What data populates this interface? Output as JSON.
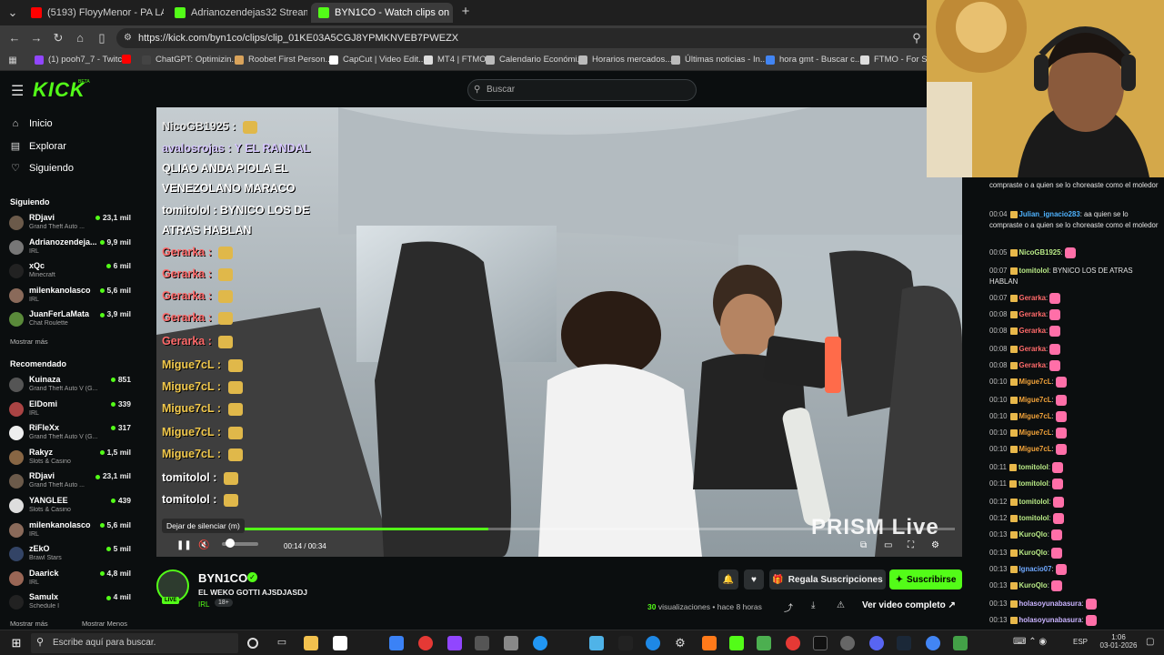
{
  "browser": {
    "tabs": [
      {
        "title": "(5193) FloyyMenor - PA LA EUR",
        "color": "#ff0000"
      },
      {
        "title": "Adrianozendejas32 Stream - W",
        "color": "#53fc18"
      },
      {
        "title": "BYN1CO - Watch clips on K",
        "color": "#53fc18",
        "active": true
      }
    ],
    "new_tab": "+",
    "url": "https://kick.com/byn1co/clips/clip_01KE03A5CGJ8YPMKNVEB7PWEZX",
    "bookmarks": [
      {
        "label": "(1) pooh7_7 - Twitch",
        "color": "#9146ff"
      },
      {
        "label": "",
        "color": "#ff0000"
      },
      {
        "label": "ChatGPT: Optimizin...",
        "color": "#444444"
      },
      {
        "label": "Roobet First Person...",
        "color": "#d9a35b"
      },
      {
        "label": "CapCut | Video Edit...",
        "color": "#ffffff"
      },
      {
        "label": "MT4 | FTMO",
        "color": "#dddddd"
      },
      {
        "label": "Calendario Económi...",
        "color": "#bbbbbb"
      },
      {
        "label": "Horarios mercados...",
        "color": "#bbbbbb"
      },
      {
        "label": "Últimas noticias - In...",
        "color": "#bbbbbb"
      },
      {
        "label": "hora gmt - Buscar c...",
        "color": "#4285f4"
      },
      {
        "label": "FTMO - For Serio",
        "color": "#dddddd"
      }
    ]
  },
  "kick": {
    "logo": "KICK",
    "logo_beta": "BETA",
    "search_placeholder": "Buscar",
    "nav": [
      "Inicio",
      "Explorar",
      "Siguiendo"
    ],
    "following_header": "Siguiendo",
    "following": [
      {
        "name": "RDjavi",
        "category": "Grand Theft Auto ...",
        "viewers": "23,1 mil",
        "color": "#6b5a4a"
      },
      {
        "name": "Adrianozendeja...",
        "category": "IRL",
        "viewers": "9,9 mil",
        "color": "#777777"
      },
      {
        "name": "xQc",
        "category": "Minecraft",
        "viewers": "6 mil",
        "color": "#222222"
      },
      {
        "name": "milenkanolasco",
        "category": "IRL",
        "viewers": "5,6 mil",
        "color": "#8a6a5a"
      },
      {
        "name": "JuanFerLaMata",
        "category": "Chat Roulette",
        "viewers": "3,9 mil",
        "color": "#5a8a3a"
      }
    ],
    "show_more": "Mostrar más",
    "recommended_header": "Recomendado",
    "recommended": [
      {
        "name": "Kuinaza",
        "category": "Grand Theft Auto V (G...",
        "viewers": "851",
        "color": "#555555"
      },
      {
        "name": "ElDomi",
        "category": "IRL",
        "viewers": "339",
        "color": "#aa4444"
      },
      {
        "name": "RiFleXx",
        "category": "Grand Theft Auto V (G...",
        "viewers": "317",
        "color": "#eeeeee"
      },
      {
        "name": "Rakyz",
        "category": "Slots & Casino",
        "viewers": "1,5 mil",
        "color": "#886644"
      },
      {
        "name": "RDjavi",
        "category": "Grand Theft Auto ...",
        "viewers": "23,1 mil",
        "color": "#6b5a4a"
      },
      {
        "name": "YANGLEE",
        "category": "Slots & Casino",
        "viewers": "439",
        "color": "#dddddd"
      },
      {
        "name": "milenkanolasco",
        "category": "IRL",
        "viewers": "5,6 mil",
        "color": "#8a6a5a"
      },
      {
        "name": "zEkO",
        "category": "Brawl Stars",
        "viewers": "5 mil",
        "color": "#334466"
      },
      {
        "name": "Daarick",
        "category": "IRL",
        "viewers": "4,8 mil",
        "color": "#996655"
      },
      {
        "name": "Samulx",
        "category": "Schedule I",
        "viewers": "4 mil",
        "color": "#222222"
      }
    ],
    "show_less": "Mostrar Menos"
  },
  "video": {
    "overlay_chat": [
      {
        "text": "NicoGB1925 : ",
        "color": "#e8e8e8"
      },
      {
        "text": "avalosrojas : Y EL RANDAL",
        "color": "#d7c7ff"
      },
      {
        "text": "QLIAO ANDA PIOLA EL",
        "color": "#ffffff"
      },
      {
        "text": "VENEZOLANO MARACO",
        "color": "#ffffff"
      },
      {
        "text": "tomitolol : BYNICO LOS DE",
        "color": "#ffffff"
      },
      {
        "text": "ATRAS HABLAN",
        "color": "#ffffff"
      },
      {
        "text": "Gerarka : ",
        "color": "#ff6a6a"
      },
      {
        "text": "Gerarka : ",
        "color": "#ff6a6a"
      },
      {
        "text": "Gerarka : ",
        "color": "#ff6a6a"
      },
      {
        "text": "Gerarka : ",
        "color": "#ff6a6a"
      },
      {
        "text": "Gerarka : ",
        "color": "#ff6a6a"
      },
      {
        "text": "Migue7cL : ",
        "color": "#f2c94c"
      },
      {
        "text": "Migue7cL : ",
        "color": "#f2c94c"
      },
      {
        "text": "Migue7cL : ",
        "color": "#f2c94c"
      },
      {
        "text": "Migue7cL : ",
        "color": "#f2c94c"
      },
      {
        "text": "Migue7cL : ",
        "color": "#f2c94c"
      },
      {
        "text": "tomitolol : ",
        "color": "#ffffff"
      },
      {
        "text": "tomitolol : ",
        "color": "#ffffff"
      }
    ],
    "tooltip": "Dejar de silenciar (m)",
    "time_current": "00:14",
    "time_total": "00:34",
    "progress": 0.41,
    "watermark": "PRISM Live"
  },
  "channel": {
    "name": "BYN1CO",
    "live_badge": "LIVE",
    "clip_title": "EL WEKO GOTTI AJSDJASDJ",
    "category": "IRL",
    "age": "18+",
    "gift_label": "Regala Suscripciones",
    "subscribe_label": "Suscribirse",
    "views_count": "30",
    "views_label": "visualizaciones",
    "time_ago": "hace 8 horas",
    "full_video_label": "Ver video completo"
  },
  "chat": [
    {
      "ts": "",
      "user": "",
      "msg": "compraste o a quien se lo choreaste como el moledor",
      "ucolor": "#e6e6e6"
    },
    {
      "ts": "00:04",
      "user": "Julian_ignacio283",
      "msg": "aa quien se lo compraste o a quien se lo choreaste como el moledor",
      "ucolor": "#4fb3ff"
    },
    {
      "ts": "00:05",
      "user": "NicoGB1925",
      "msg": "",
      "ucolor": "#b8e986"
    },
    {
      "ts": "00:07",
      "user": "tomitolol",
      "msg": "BYNICO LOS DE ATRAS HABLAN",
      "ucolor": "#b8e986"
    },
    {
      "ts": "00:07",
      "user": "Gerarka",
      "msg": "",
      "ucolor": "#ff6a6a"
    },
    {
      "ts": "00:08",
      "user": "Gerarka",
      "msg": "",
      "ucolor": "#ff6a6a"
    },
    {
      "ts": "00:08",
      "user": "Gerarka",
      "msg": "",
      "ucolor": "#ff6a6a"
    },
    {
      "ts": "00:08",
      "user": "Gerarka",
      "msg": "",
      "ucolor": "#ff6a6a"
    },
    {
      "ts": "00:08",
      "user": "Gerarka",
      "msg": "",
      "ucolor": "#ff6a6a"
    },
    {
      "ts": "00:10",
      "user": "Migue7cL",
      "msg": "",
      "ucolor": "#f2a33a"
    },
    {
      "ts": "00:10",
      "user": "Migue7cL",
      "msg": "",
      "ucolor": "#f2a33a"
    },
    {
      "ts": "00:10",
      "user": "Migue7cL",
      "msg": "",
      "ucolor": "#f2a33a"
    },
    {
      "ts": "00:10",
      "user": "Migue7cL",
      "msg": "",
      "ucolor": "#f2a33a"
    },
    {
      "ts": "00:10",
      "user": "Migue7cL",
      "msg": "",
      "ucolor": "#f2a33a"
    },
    {
      "ts": "00:11",
      "user": "tomitolol",
      "msg": "",
      "ucolor": "#b8e986"
    },
    {
      "ts": "00:11",
      "user": "tomitolol",
      "msg": "",
      "ucolor": "#b8e986"
    },
    {
      "ts": "00:12",
      "user": "tomitolol",
      "msg": "",
      "ucolor": "#b8e986"
    },
    {
      "ts": "00:12",
      "user": "tomitolol",
      "msg": "",
      "ucolor": "#b8e986"
    },
    {
      "ts": "00:13",
      "user": "KuroQlo",
      "msg": "",
      "ucolor": "#b8e986"
    },
    {
      "ts": "00:13",
      "user": "KuroQlo",
      "msg": "",
      "ucolor": "#b8e986"
    },
    {
      "ts": "00:13",
      "user": "Ignacio07",
      "msg": "",
      "ucolor": "#6fa8ff"
    },
    {
      "ts": "00:13",
      "user": "KuroQlo",
      "msg": "",
      "ucolor": "#b8e986"
    },
    {
      "ts": "00:13",
      "user": "holasoyunabasura",
      "msg": "",
      "ucolor": "#c9b3ff"
    },
    {
      "ts": "00:13",
      "user": "holasoyunabasura",
      "msg": "",
      "ucolor": "#c9b3ff"
    }
  ],
  "taskbar": {
    "search_placeholder": "Escribe aquí para buscar.",
    "lang": "ESP",
    "time": "1:06",
    "date": "03-01-2026"
  },
  "colors": {
    "accent": "#53fc18",
    "bg": "#0b0e0f"
  }
}
